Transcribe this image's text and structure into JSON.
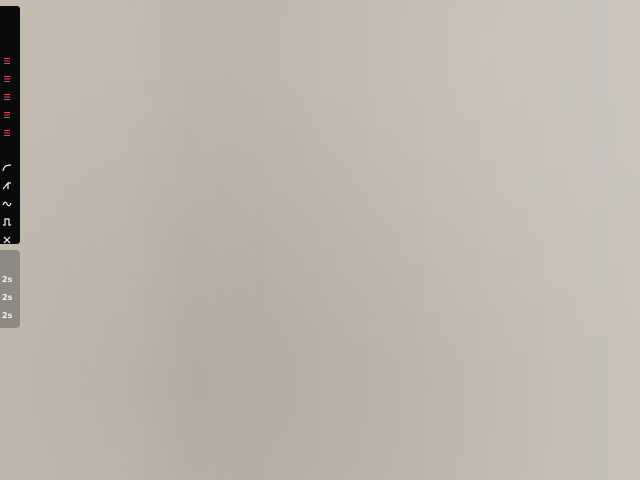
{
  "colors": {
    "toolbar_bg": "#0a0a0a",
    "icon_red": "#e0445a",
    "icon_white": "#f2f2f2",
    "panel_bg": "#8e8a82"
  },
  "toolbar": {
    "menu_items": [
      {
        "icon": "menu-lines-icon",
        "color": "#e0445a"
      },
      {
        "icon": "menu-lines-icon",
        "color": "#e0445a"
      },
      {
        "icon": "menu-lines-icon",
        "color": "#e0445a"
      },
      {
        "icon": "menu-lines-icon",
        "color": "#e0445a"
      },
      {
        "icon": "menu-lines-icon",
        "color": "#e0445a"
      },
      {
        "icon": "menu-lines-icon",
        "color": "#e0445a"
      }
    ],
    "wave_tools": [
      {
        "icon": "curve-wave-icon"
      },
      {
        "icon": "sawtooth-wave-icon"
      },
      {
        "icon": "sine-wave-icon"
      },
      {
        "icon": "square-wave-icon"
      },
      {
        "icon": "close-icon"
      }
    ]
  },
  "speed_panel": {
    "items": [
      {
        "label": "2s"
      },
      {
        "label": "2s"
      },
      {
        "label": "2s"
      }
    ]
  }
}
